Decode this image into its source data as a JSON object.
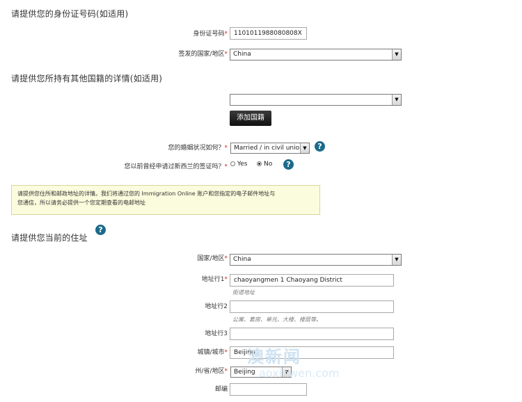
{
  "sections": {
    "id_title": "请提供您的身份证号码(如适用)",
    "nationality_title": "请提供您所持有其他国籍的详情(如适用)",
    "address_title": "请提供您当前的住址"
  },
  "id_card": {
    "label": "身份证号码",
    "value": "1101011988080808X"
  },
  "issuing_country": {
    "label": "签发的国家/地区",
    "value": "China"
  },
  "nationality": {
    "value": "",
    "add_button": "添加国籍"
  },
  "marital": {
    "label": "您的婚姻状况如何？",
    "value": "Married / in civil union"
  },
  "prior_visa": {
    "label": "您以前曾经申请过新西兰的签证吗？",
    "yes": "Yes",
    "no": "No",
    "selected": "No"
  },
  "info_box": {
    "line1": "请提供您住所和邮政地址的详情。我们将通过您的 Immigration Online 账户和您指定的电子邮件地址与",
    "line2": "您通信，所以请务必提供一个您定期查看的电邮地址"
  },
  "address": {
    "country_label": "国家/地区",
    "country_value": "China",
    "line1_label": "地址行1",
    "line1_value": "chaoyangmen 1  Chaoyang District",
    "line1_hint": "街道地址",
    "line2_label": "地址行2",
    "line2_value": "",
    "line2_hint": "公寓、套房、单元、大楼、楼层等。",
    "line3_label": "地址行3",
    "line3_value": "",
    "city_label": "城镇/城市",
    "city_value": "Beijing",
    "state_label": "州/省/地区",
    "state_value": "Beijing",
    "postcode_label": "邮编",
    "postcode_value": ""
  },
  "required_mark": "*",
  "help_glyph": "?",
  "watermark": {
    "text": "澳新闻",
    "sub": "aoxinwen.com"
  }
}
